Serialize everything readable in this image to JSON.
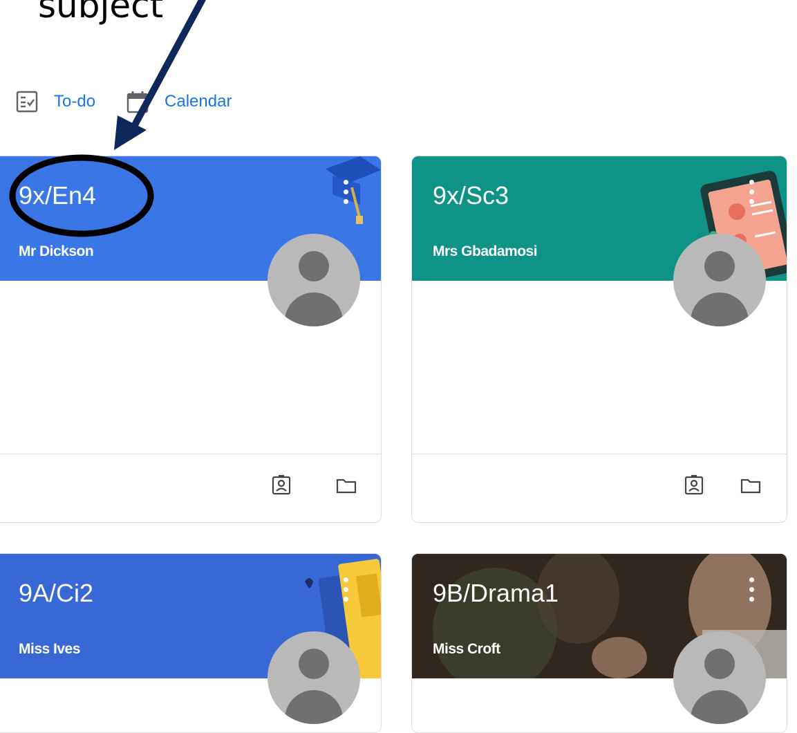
{
  "annotation": {
    "text": "subject",
    "hidden_line": ""
  },
  "nav": {
    "todo_label": "To-do",
    "calendar_label": "Calendar"
  },
  "colors": {
    "blue_header": "#3b76e6",
    "teal_header": "#0f9386",
    "blue2_header": "#3768d6",
    "drama_header": "#4a3a2e",
    "accent": "#1a73e8",
    "arrow": "#10275a"
  },
  "cards": [
    {
      "title": "9x/En4",
      "teacher": "Mr Dickson"
    },
    {
      "title": "9x/Sc3",
      "teacher": "Mrs Gbadamosi"
    },
    {
      "title": "9A/Ci2",
      "teacher": "Miss Ives"
    },
    {
      "title": "9B/Drama1",
      "teacher": "Miss Croft"
    }
  ],
  "icons": {
    "todo": "todo-list-icon",
    "calendar": "calendar-icon",
    "people": "people-icon",
    "folder": "folder-icon",
    "menu": "more-vert-icon"
  }
}
